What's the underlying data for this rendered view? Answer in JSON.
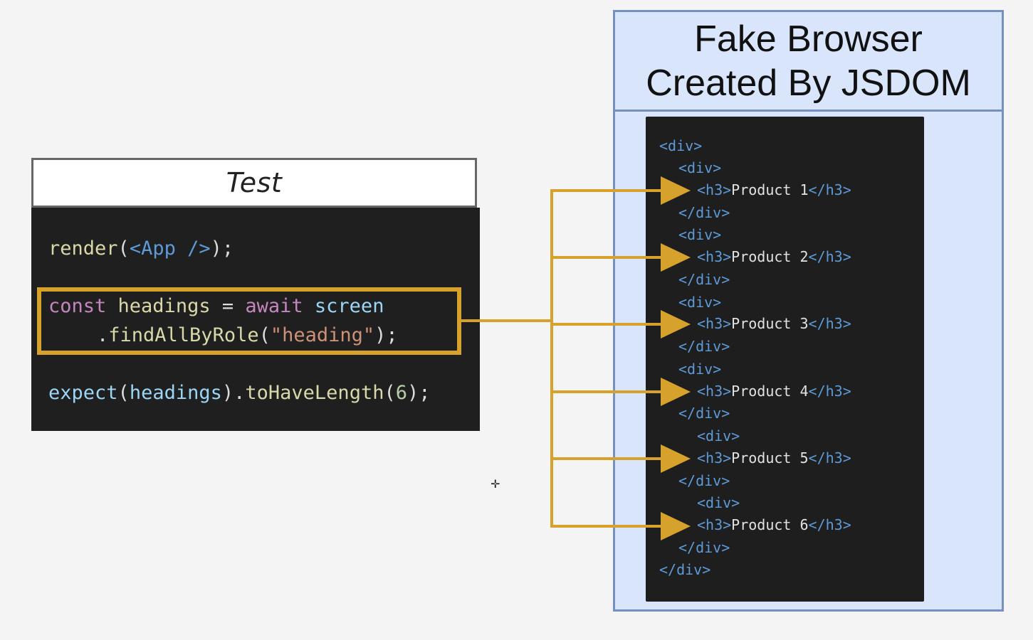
{
  "test_panel": {
    "title": "Test",
    "code": {
      "line1": {
        "fn": "render",
        "open": "(",
        "jsx": "<App />",
        "close": ");"
      },
      "line2": {
        "kw1": "const",
        "var1": " headings",
        "op": " = ",
        "kw2": "await",
        "var2": " screen"
      },
      "line3": {
        "dot": ".",
        "fn": "findAllByRole",
        "open": "(",
        "str": "\"heading\"",
        "close": ");"
      },
      "line4": {
        "fn1": "expect",
        "open1": "(",
        "var": "headings",
        "close1": ")",
        "dot": ".",
        "fn2": "toHaveLength",
        "open2": "(",
        "num": "6",
        "close2": ");"
      }
    }
  },
  "browser_panel": {
    "title_line1": "Fake Browser",
    "title_line2": "Created By JSDOM",
    "dom": {
      "div_open": "<div>",
      "div_close": "</div>",
      "h3_open": "<h3>",
      "h3_close": "</h3>",
      "products": [
        "Product 1",
        "Product 2",
        "Product 3",
        "Product 4",
        "Product 5",
        "Product 6"
      ]
    }
  },
  "colors": {
    "arrow": "#d7a22c",
    "browser_bg": "#d9e5fb",
    "browser_border": "#7790c2",
    "code_bg": "#1f1f1f"
  }
}
